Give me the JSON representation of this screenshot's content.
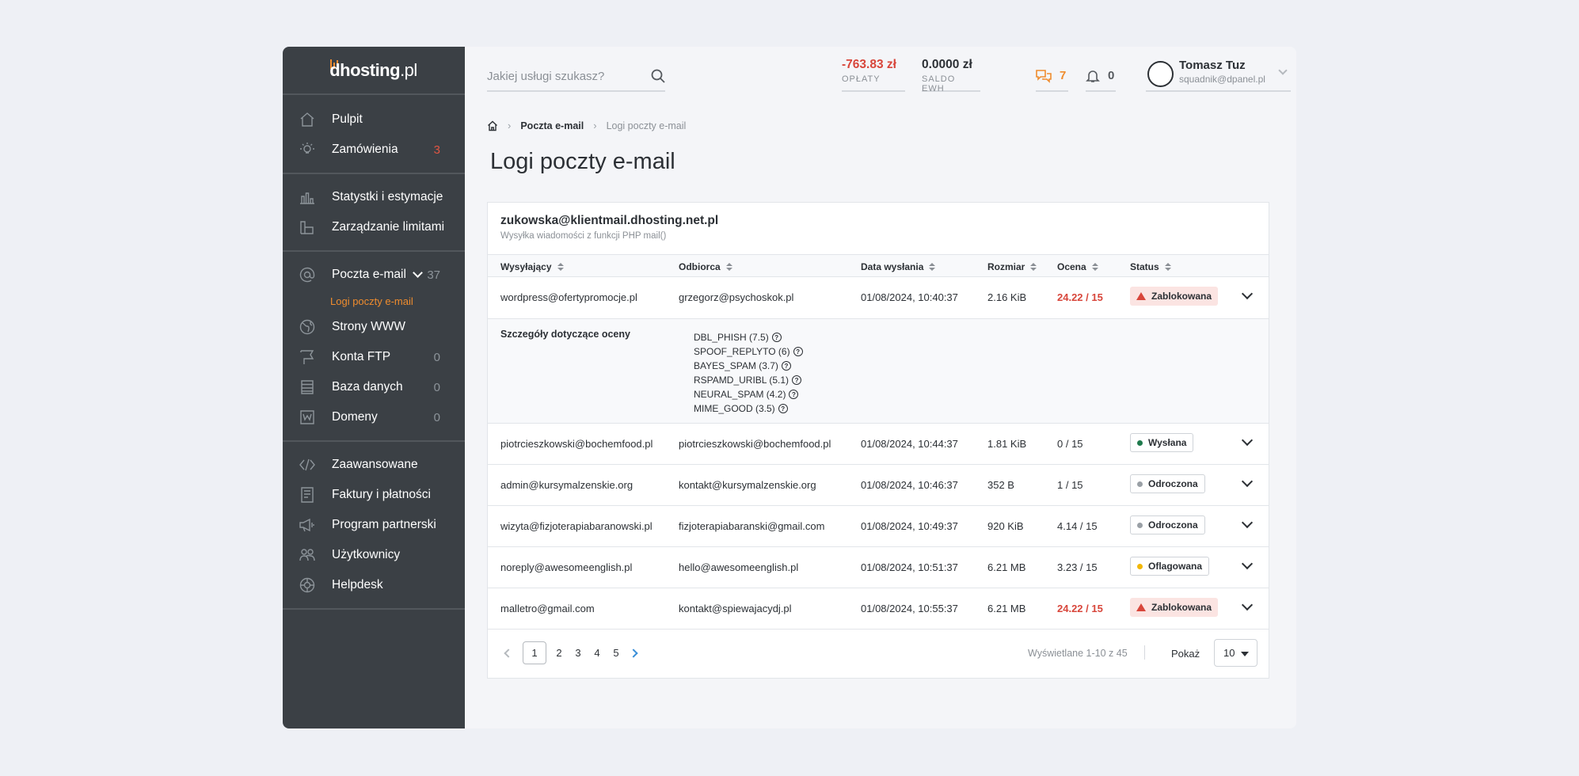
{
  "brand": {
    "name_bold": "dhosting",
    "name_tld": ".pl"
  },
  "sidebar": {
    "groups": [
      [
        {
          "label": "Pulpit",
          "icon": "home-icon",
          "count": ""
        },
        {
          "label": "Zamówienia",
          "icon": "lightbulb-icon",
          "count": "3",
          "count_color": "#e05543"
        }
      ],
      [
        {
          "label": "Statystki i estymacje",
          "icon": "chart-icon",
          "count": ""
        },
        {
          "label": "Zarządzanie limitami",
          "icon": "limits-icon",
          "count": ""
        }
      ],
      [
        {
          "label": "Poczta e-mail",
          "icon": "at-icon",
          "count": "37",
          "expanded": true,
          "sub": "Logi poczty e-mail"
        },
        {
          "label": "Strony WWW",
          "icon": "globe-icon",
          "count": ""
        },
        {
          "label": "Konta FTP",
          "icon": "flag-icon",
          "count": "0"
        },
        {
          "label": "Baza danych",
          "icon": "database-icon",
          "count": "0"
        },
        {
          "label": "Domeny",
          "icon": "domain-icon",
          "count": "0"
        }
      ],
      [
        {
          "label": "Zaawansowane",
          "icon": "code-icon",
          "count": ""
        },
        {
          "label": "Faktury i płatności",
          "icon": "invoice-icon",
          "count": ""
        },
        {
          "label": "Program partnerski",
          "icon": "megaphone-icon",
          "count": ""
        },
        {
          "label": "Użytkownicy",
          "icon": "users-icon",
          "count": ""
        },
        {
          "label": "Helpdesk",
          "icon": "lifebuoy-icon",
          "count": ""
        }
      ]
    ]
  },
  "topbar": {
    "search_placeholder": "Jakiej usługi szukasz?",
    "fees": {
      "value": "-763.83 zł",
      "label": "OPŁATY"
    },
    "ewh": {
      "value": "0.0000 zł",
      "label": "SALDO EWH"
    },
    "messages_count": "7",
    "notifications_count": "0",
    "user": {
      "name": "Tomasz Tuz",
      "email": "squadnik@dpanel.pl"
    }
  },
  "breadcrumb": {
    "level1": "Poczta e-mail",
    "level2": "Logi poczty e-mail"
  },
  "page_title": "Logi poczty e-mail",
  "card": {
    "title": "zukowska@klientmail.dhosting.net.pl",
    "subtitle": "Wysyłka wiadomości z funkcji PHP mail()",
    "columns": [
      "Wysyłający",
      "Odbiorca",
      "Data wysłania",
      "Rozmiar",
      "Ocena",
      "Status"
    ],
    "rows": [
      {
        "from": "wordpress@ofertypromocje.pl",
        "to": "grzegorz@psychoskok.pl",
        "date": "01/08/2024, 10:40:37",
        "size": "2.16 KiB",
        "score": "24.22 / 15",
        "score_high": true,
        "status": "Zablokowana",
        "status_type": "blocked"
      },
      {
        "from": "piotrcieszkowski@bochemfood.pl",
        "to": "piotrcieszkowski@bochemfood.pl",
        "date": "01/08/2024, 10:44:37",
        "size": "1.81 KiB",
        "score": "0 / 15",
        "score_high": false,
        "status": "Wysłana",
        "status_type": "outline",
        "dot": "#1f7a4d"
      },
      {
        "from": "admin@kursymalzenskie.org",
        "to": "kontakt@kursymalzenskie.org",
        "date": "01/08/2024, 10:46:37",
        "size": "352 B",
        "score": "1 / 15",
        "score_high": false,
        "status": "Odroczona",
        "status_type": "outline",
        "dot": "#9aa0a6"
      },
      {
        "from": "wizyta@fizjoterapiabaranowski.pl",
        "to": "fizjoterapiabaranski@gmail.com",
        "date": "01/08/2024, 10:49:37",
        "size": "920 KiB",
        "score": "4.14 / 15",
        "score_high": false,
        "status": "Odroczona",
        "status_type": "outline",
        "dot": "#9aa0a6"
      },
      {
        "from": "noreply@awesomeenglish.pl",
        "to": "hello@awesomeenglish.pl",
        "date": "01/08/2024, 10:51:37",
        "size": "6.21 MB",
        "score": "3.23 / 15",
        "score_high": false,
        "status": "Oflagowana",
        "status_type": "outline",
        "dot": "#f2b705"
      },
      {
        "from": "malletro@gmail.com",
        "to": "kontakt@spiewajacydj.pl",
        "date": "01/08/2024, 10:55:37",
        "size": "6.21 MB",
        "score": "24.22 / 15",
        "score_high": true,
        "status": "Zablokowana",
        "status_type": "blocked"
      }
    ],
    "details": {
      "label": "Szczegóły dotyczące oceny",
      "items": [
        "DBL_PHISH (7.5)",
        "SPOOF_REPLYTO (6)",
        "BAYES_SPAM (3.7)",
        "RSPAMD_URIBL (5.1)",
        "NEURAL_SPAM (4.2)",
        "MIME_GOOD (3.5)"
      ]
    }
  },
  "pagination": {
    "pages": [
      "1",
      "2",
      "3",
      "4",
      "5"
    ],
    "current": "1",
    "shown_text": "Wyświetlane 1-10 z 45",
    "show_label": "Pokaż",
    "page_size": "10"
  },
  "colors": {
    "accent": "#ef8c2e",
    "danger": "#d8463b",
    "sidebar": "#3b4045",
    "link": "#3a8fd8"
  }
}
